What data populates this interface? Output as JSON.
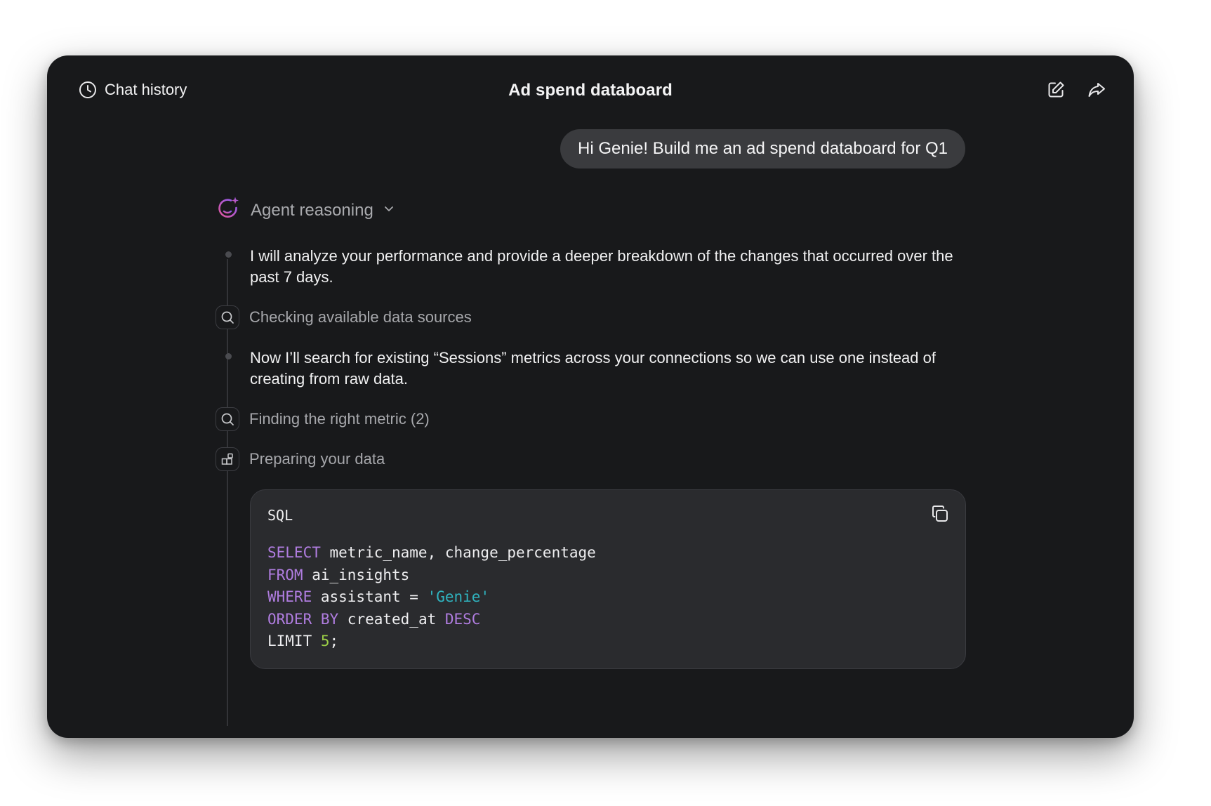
{
  "header": {
    "chat_history_label": "Chat history",
    "title": "Ad spend databoard",
    "actions": [
      {
        "name": "edit",
        "icon": "edit-icon"
      },
      {
        "name": "share",
        "icon": "share-icon"
      }
    ]
  },
  "conversation": {
    "user_message": "Hi Genie! Build me an ad spend databoard for Q1"
  },
  "reasoning": {
    "label": "Agent reasoning",
    "icon": "genie-sparkle-icon",
    "steps": [
      {
        "type": "text",
        "text": "I will analyze your performance and provide a deeper breakdown of the changes that occurred over the past 7 days."
      },
      {
        "type": "action",
        "icon": "search-icon",
        "text": "Checking available data sources"
      },
      {
        "type": "text",
        "text": "Now I’ll search for existing “Sessions” metrics across your connections so we can use one instead of creating from raw data."
      },
      {
        "type": "action",
        "icon": "search-icon",
        "text": "Finding the right metric (2)"
      },
      {
        "type": "action",
        "icon": "data-blocks-icon",
        "text": "Preparing your data"
      }
    ]
  },
  "code_block": {
    "language": "SQL",
    "lines": [
      [
        {
          "t": "kw",
          "v": "SELECT"
        },
        {
          "t": "plain",
          "v": " metric_name, change_percentage"
        }
      ],
      [
        {
          "t": "kw",
          "v": "FROM"
        },
        {
          "t": "plain",
          "v": " ai_insights"
        }
      ],
      [
        {
          "t": "kw",
          "v": "WHERE"
        },
        {
          "t": "plain",
          "v": " assistant = "
        },
        {
          "t": "str",
          "v": "'Genie'"
        }
      ],
      [
        {
          "t": "kw",
          "v": "ORDER BY"
        },
        {
          "t": "plain",
          "v": " created_at "
        },
        {
          "t": "kw",
          "v": "DESC"
        }
      ],
      [
        {
          "t": "plain",
          "v": "LIMIT "
        },
        {
          "t": "num",
          "v": "5"
        },
        {
          "t": "plain",
          "v": ";"
        }
      ]
    ]
  },
  "colors": {
    "background": "#18191b",
    "bubble": "#3a3b3e",
    "keyword": "#b07de0",
    "string": "#2fb3bf",
    "number": "#9ccf47",
    "genie_gradient_start": "#e0559a",
    "genie_gradient_end": "#8b5cf6"
  }
}
